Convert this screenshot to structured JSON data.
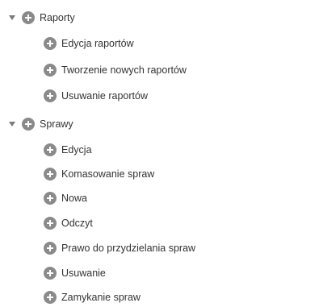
{
  "tree": {
    "groups": [
      {
        "label": "Raporty",
        "expanded": true,
        "children": [
          {
            "label": "Edycja raportów"
          },
          {
            "label": "Tworzenie nowych raportów"
          },
          {
            "label": "Usuwanie raportów"
          }
        ]
      },
      {
        "label": "Sprawy",
        "expanded": true,
        "children": [
          {
            "label": "Edycja"
          },
          {
            "label": "Komasowanie spraw"
          },
          {
            "label": "Nowa"
          },
          {
            "label": "Odczyt"
          },
          {
            "label": "Prawo do przydzielania spraw"
          },
          {
            "label": "Usuwanie"
          },
          {
            "label": "Zamykanie spraw"
          }
        ]
      }
    ]
  }
}
